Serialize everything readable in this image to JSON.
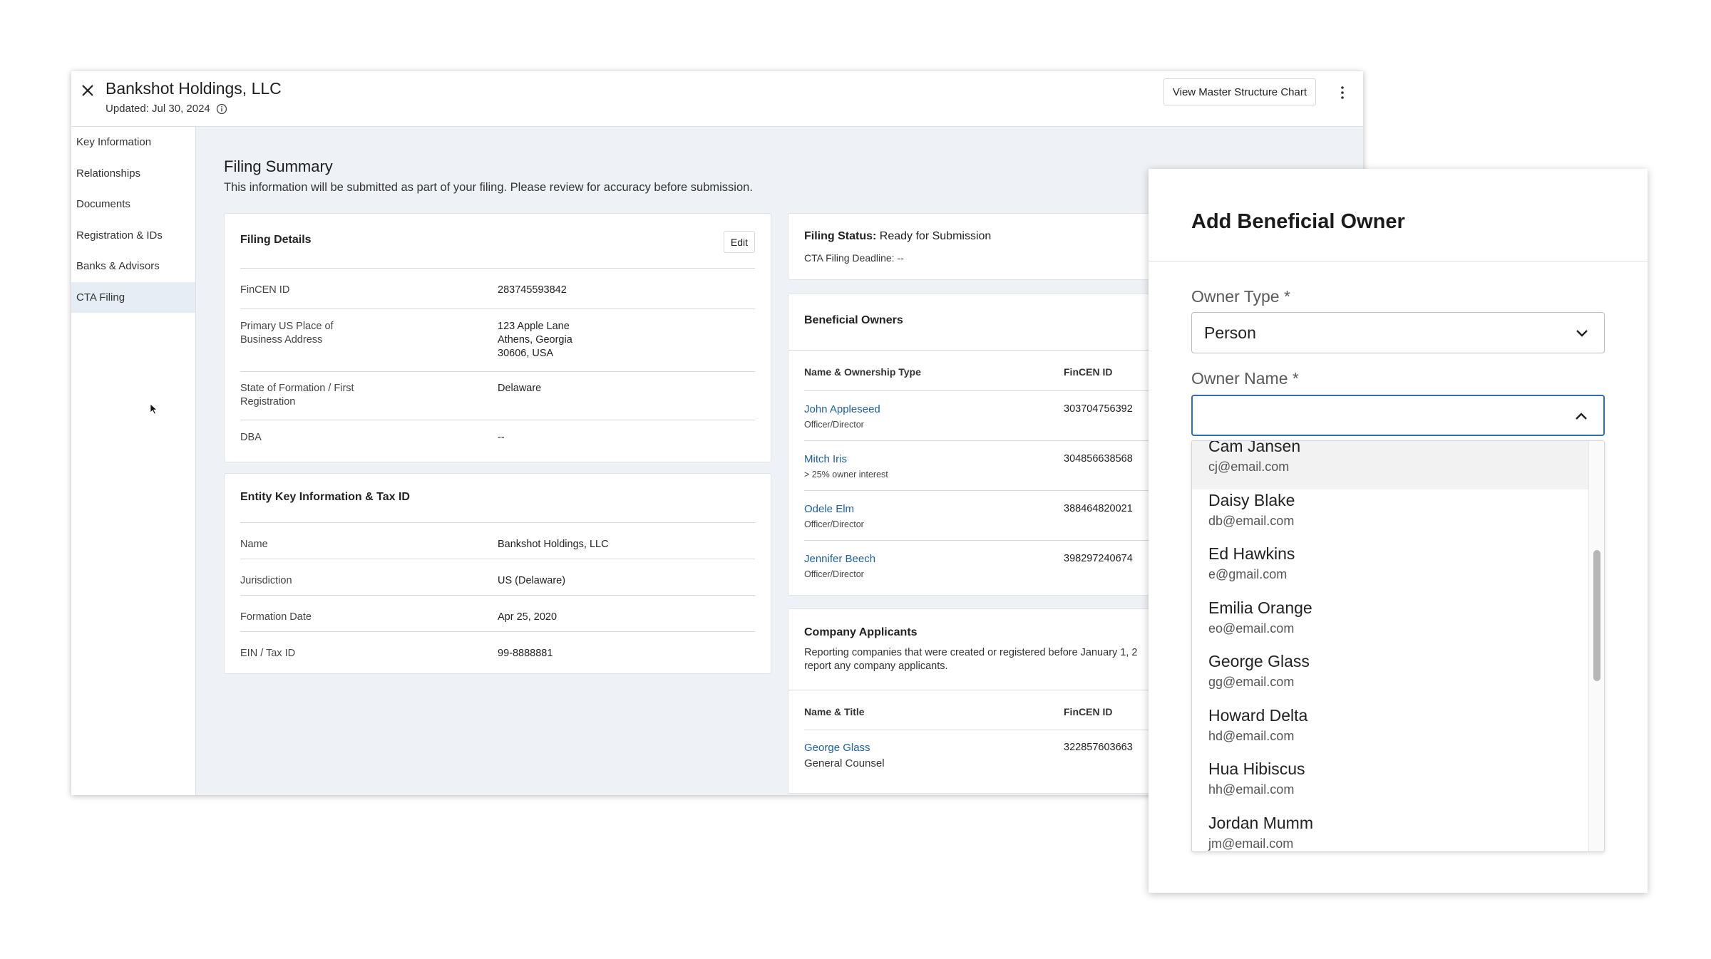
{
  "header": {
    "entity_name": "Bankshot Holdings, LLC",
    "updated": "Updated: Jul 30, 2024",
    "master_chart_button": "View Master Structure Chart"
  },
  "sidebar": {
    "items": [
      {
        "label": "Key Information"
      },
      {
        "label": "Relationships"
      },
      {
        "label": "Documents"
      },
      {
        "label": "Registration & IDs"
      },
      {
        "label": "Banks & Advisors"
      },
      {
        "label": "CTA Filing",
        "active": true
      }
    ]
  },
  "summary": {
    "title": "Filing Summary",
    "description": "This information will be submitted as part of your filing. Please review for accuracy before submission."
  },
  "filing_details": {
    "title": "Filing Details",
    "edit_label": "Edit",
    "rows": [
      {
        "label": "FinCEN ID",
        "value": "283745593842"
      },
      {
        "label": "Primary US Place of\nBusiness Address",
        "value": "123 Apple Lane\nAthens, Georgia\n30606, USA"
      },
      {
        "label": "State of Formation / First\nRegistration",
        "value": "Delaware"
      },
      {
        "label": "DBA",
        "value": "--"
      }
    ]
  },
  "entity_key": {
    "title": "Entity Key Information & Tax ID",
    "rows": [
      {
        "label": "Name",
        "value": "Bankshot Holdings, LLC"
      },
      {
        "label": "Jurisdiction",
        "value": "US (Delaware)"
      },
      {
        "label": "Formation Date",
        "value": "Apr 25, 2020"
      },
      {
        "label": "EIN / Tax ID",
        "value": "99-8888881"
      }
    ]
  },
  "filing_status": {
    "label": "Filing Status:",
    "value": "Ready for Submission",
    "deadline": "CTA Filing Deadline: --"
  },
  "beneficial_owners": {
    "title": "Beneficial Owners",
    "col_name": "Name & Ownership Type",
    "col_id": "FinCEN ID",
    "rows": [
      {
        "name": "John Appleseed",
        "type": "Officer/Director",
        "id": "303704756392"
      },
      {
        "name": "Mitch Iris",
        "type": "> 25% owner interest",
        "id": "304856638568"
      },
      {
        "name": "Odele Elm",
        "type": "Officer/Director",
        "id": "388464820021"
      },
      {
        "name": "Jennifer Beech",
        "type": "Officer/Director",
        "id": "398297240674"
      }
    ]
  },
  "company_applicants": {
    "title": "Company Applicants",
    "description_line1": "Reporting companies that were created or registered before January 1, 2",
    "description_line2": "report any company applicants.",
    "col_name": "Name & Title",
    "col_id": "FinCEN ID",
    "rows": [
      {
        "name": "George Glass",
        "title": "General Counsel",
        "id": "322857603663"
      }
    ]
  },
  "modal": {
    "title": "Add Beneficial Owner",
    "owner_type_label": "Owner Type *",
    "owner_type_value": "Person",
    "owner_name_label": "Owner Name *",
    "owner_name_value": "",
    "options": [
      {
        "name": "Cam Jansen",
        "email": "cj@email.com"
      },
      {
        "name": "Daisy Blake",
        "email": "db@email.com"
      },
      {
        "name": "Ed Hawkins",
        "email": "e@gmail.com"
      },
      {
        "name": "Emilia Orange",
        "email": "eo@email.com"
      },
      {
        "name": "George Glass",
        "email": "gg@email.com"
      },
      {
        "name": "Howard Delta",
        "email": "hd@email.com"
      },
      {
        "name": "Hua Hibiscus",
        "email": "hh@email.com"
      },
      {
        "name": "Jordan Mumm",
        "email": "jm@email.com"
      }
    ],
    "hovered_option": "Cam Jansen"
  }
}
